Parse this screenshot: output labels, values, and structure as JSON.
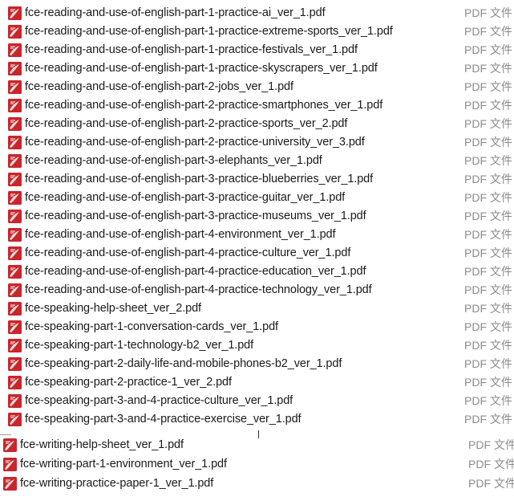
{
  "files_group_a": [
    {
      "name": "fce-reading-and-use-of-english-part-1-practice-ai_ver_1.pdf",
      "type": "PDF 文件"
    },
    {
      "name": "fce-reading-and-use-of-english-part-1-practice-extreme-sports_ver_1.pdf",
      "type": "PDF 文件"
    },
    {
      "name": "fce-reading-and-use-of-english-part-1-practice-festivals_ver_1.pdf",
      "type": "PDF 文件"
    },
    {
      "name": "fce-reading-and-use-of-english-part-1-practice-skyscrapers_ver_1.pdf",
      "type": "PDF 文件"
    },
    {
      "name": "fce-reading-and-use-of-english-part-2-jobs_ver_1.pdf",
      "type": "PDF 文件"
    },
    {
      "name": "fce-reading-and-use-of-english-part-2-practice-smartphones_ver_1.pdf",
      "type": "PDF 文件"
    },
    {
      "name": "fce-reading-and-use-of-english-part-2-practice-sports_ver_2.pdf",
      "type": "PDF 文件"
    },
    {
      "name": "fce-reading-and-use-of-english-part-2-practice-university_ver_3.pdf",
      "type": "PDF 文件"
    },
    {
      "name": "fce-reading-and-use-of-english-part-3-elephants_ver_1.pdf",
      "type": "PDF 文件"
    },
    {
      "name": "fce-reading-and-use-of-english-part-3-practice-blueberries_ver_1.pdf",
      "type": "PDF 文件"
    },
    {
      "name": "fce-reading-and-use-of-english-part-3-practice-guitar_ver_1.pdf",
      "type": "PDF 文件"
    },
    {
      "name": "fce-reading-and-use-of-english-part-3-practice-museums_ver_1.pdf",
      "type": "PDF 文件"
    },
    {
      "name": "fce-reading-and-use-of-english-part-4-environment_ver_1.pdf",
      "type": "PDF 文件"
    },
    {
      "name": "fce-reading-and-use-of-english-part-4-practice-culture_ver_1.pdf",
      "type": "PDF 文件"
    },
    {
      "name": "fce-reading-and-use-of-english-part-4-practice-education_ver_1.pdf",
      "type": "PDF 文件"
    },
    {
      "name": "fce-reading-and-use-of-english-part-4-practice-technology_ver_1.pdf",
      "type": "PDF 文件"
    },
    {
      "name": "fce-speaking-help-sheet_ver_2.pdf",
      "type": "PDF 文件"
    },
    {
      "name": "fce-speaking-part-1-conversation-cards_ver_1.pdf",
      "type": "PDF 文件"
    },
    {
      "name": "fce-speaking-part-1-technology-b2_ver_1.pdf",
      "type": "PDF 文件"
    },
    {
      "name": "fce-speaking-part-2-daily-life-and-mobile-phones-b2_ver_1.pdf",
      "type": "PDF 文件"
    },
    {
      "name": "fce-speaking-part-2-practice-1_ver_2.pdf",
      "type": "PDF 文件"
    },
    {
      "name": "fce-speaking-part-3-and-4-practice-culture_ver_1.pdf",
      "type": "PDF 文件"
    },
    {
      "name": "fce-speaking-part-3-and-4-practice-exercise_ver_1.pdf",
      "type": "PDF 文件"
    }
  ],
  "files_group_b": [
    {
      "name": "fce-writing-help-sheet_ver_1.pdf",
      "type": "PDF 文件"
    },
    {
      "name": "fce-writing-part-1-environment_ver_1.pdf",
      "type": "PDF 文件"
    },
    {
      "name": "fce-writing-practice-paper-1_ver_1.pdf",
      "type": "PDF 文件"
    }
  ],
  "icon": {
    "name": "pdf-file-icon",
    "color": "#c9262c"
  },
  "colors": {
    "filename": "#1a1a1a",
    "type": "#8c8c8c"
  }
}
